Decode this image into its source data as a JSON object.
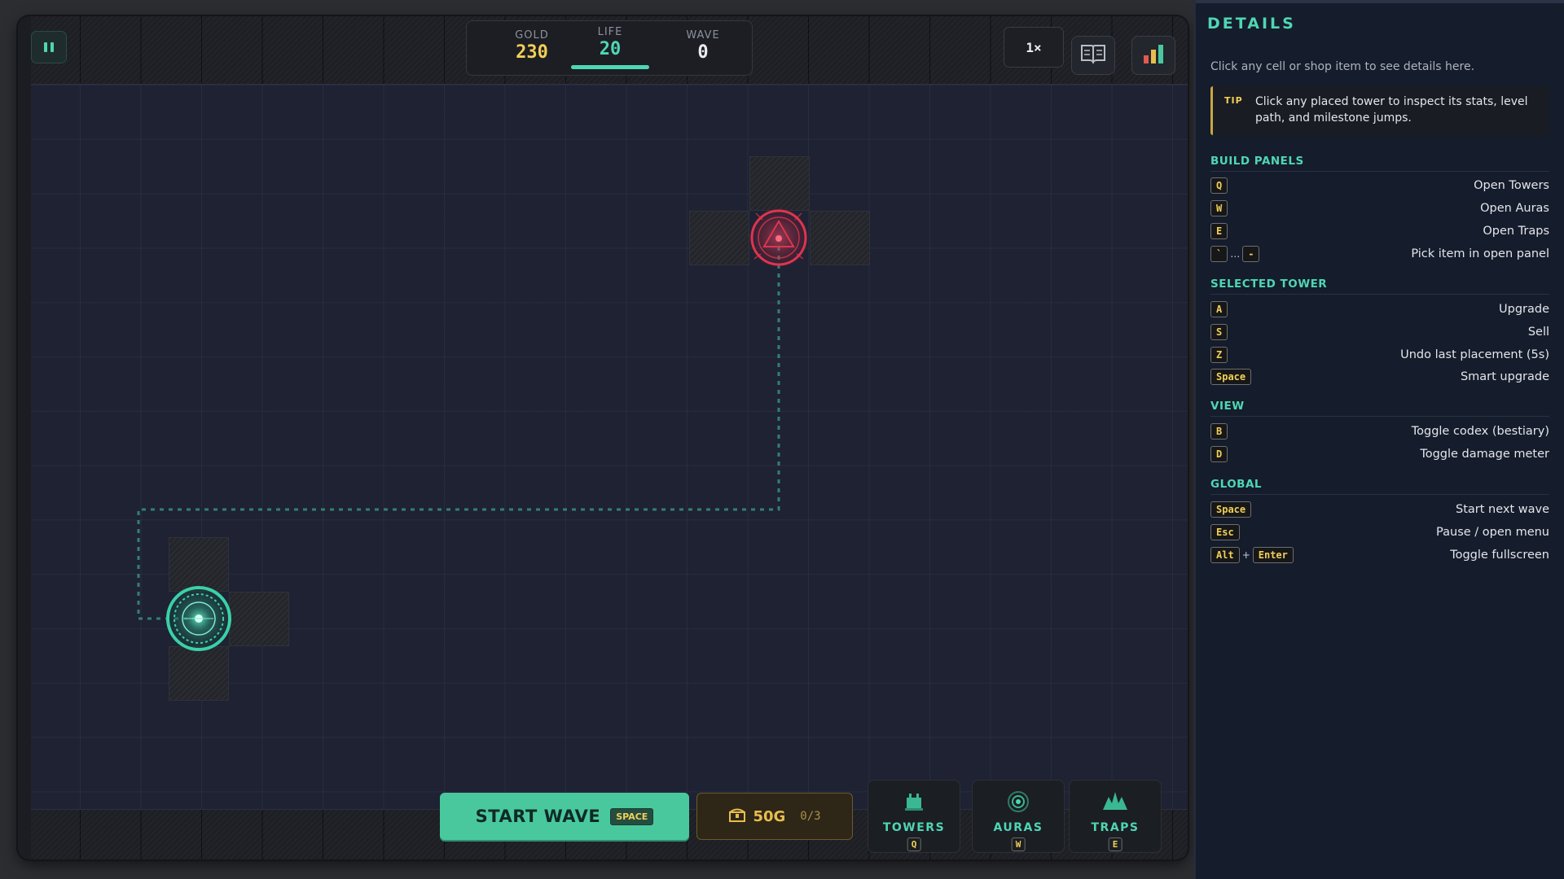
{
  "hud": {
    "gold_label": "GOLD",
    "gold_value": "230",
    "life_label": "LIFE",
    "life_value": "20",
    "wave_label": "WAVE",
    "wave_value": "0",
    "speed_label": "1×"
  },
  "bottom_bar": {
    "start_wave_label": "START WAVE",
    "start_wave_key": "SPACE",
    "summon_cost": "50G",
    "summon_count": "0/3",
    "tabs": [
      {
        "label": "TOWERS",
        "key": "Q",
        "icon": "tower-icon"
      },
      {
        "label": "AURAS",
        "key": "W",
        "icon": "aura-icon"
      },
      {
        "label": "TRAPS",
        "key": "E",
        "icon": "trap-icon"
      }
    ]
  },
  "details": {
    "title": "DETAILS",
    "hint": "Click any cell or shop item to see details here.",
    "tip_label": "TIP",
    "tip_text": "Click any placed tower to inspect its stats, level path, and milestone jumps.",
    "sections": [
      {
        "title": "BUILD PANELS",
        "rows": [
          {
            "keys": [
              "Q"
            ],
            "desc": "Open Towers"
          },
          {
            "keys": [
              "W"
            ],
            "desc": "Open Auras"
          },
          {
            "keys": [
              "E"
            ],
            "desc": "Open Traps"
          },
          {
            "keys": [
              "`",
              "-"
            ],
            "sep": "…",
            "desc": "Pick item in open panel"
          }
        ]
      },
      {
        "title": "SELECTED TOWER",
        "rows": [
          {
            "keys": [
              "A"
            ],
            "desc": "Upgrade"
          },
          {
            "keys": [
              "S"
            ],
            "desc": "Sell"
          },
          {
            "keys": [
              "Z"
            ],
            "desc": "Undo last placement (5s)"
          },
          {
            "keys": [
              "Space"
            ],
            "desc": "Smart upgrade"
          }
        ]
      },
      {
        "title": "VIEW",
        "rows": [
          {
            "keys": [
              "B"
            ],
            "desc": "Toggle codex (bestiary)"
          },
          {
            "keys": [
              "D"
            ],
            "desc": "Toggle damage meter"
          }
        ]
      },
      {
        "title": "GLOBAL",
        "rows": [
          {
            "keys": [
              "Space"
            ],
            "desc": "Start next wave"
          },
          {
            "keys": [
              "Esc"
            ],
            "desc": "Pause / open menu"
          },
          {
            "keys": [
              "Alt",
              "Enter"
            ],
            "sep": "+",
            "desc": "Toggle fullscreen"
          }
        ]
      }
    ]
  },
  "colors": {
    "accent": "#4fd6b4",
    "gold": "#f2cf57",
    "spawn_portal": "#e0344f",
    "base_portal": "#3ad1a8",
    "board": "#1e2233"
  },
  "icons": [
    "pause-icon",
    "book-icon",
    "bar-chart-icon",
    "chest-icon",
    "spawn-portal-icon",
    "base-portal-icon"
  ]
}
